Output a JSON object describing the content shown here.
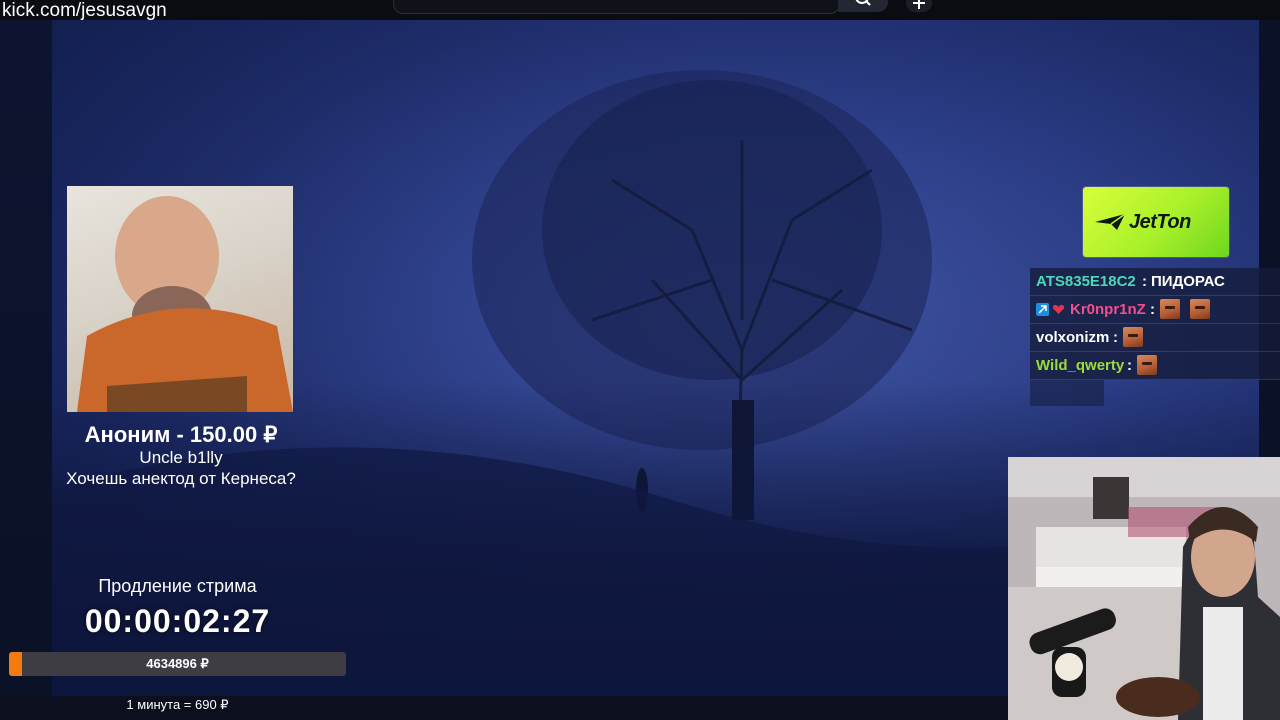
{
  "url": "kick.com/jesusavgn",
  "icons": {
    "search": "search-icon",
    "plus": "plus-icon",
    "sponsor_logo": "paper-plane-logo-icon",
    "chat_badge": "chat-badge-icon",
    "chat_heart": "heart-badge-icon",
    "emote": "emote-icon"
  },
  "donation": {
    "amount_line": "Аноним - 150.00 ₽",
    "name": "Uncle b1lly",
    "message": "Хочешь анектод от Кернеса?"
  },
  "extension": {
    "title": "Продление стрима",
    "timer": "00:00:02:27",
    "total": "4634896 ₽",
    "progress_fraction": 0.04,
    "rate": "1 минута = 690 ₽"
  },
  "sponsor": {
    "name": "JetTon"
  },
  "chat": [
    {
      "user": "ATS835E18C2",
      "user_color": "#4fd8b7",
      "text": "ПИДОРАС",
      "emotes": 0
    },
    {
      "user": "Kr0npr1nZ",
      "user_color": "#f24f8a",
      "text": "",
      "emotes": 2
    },
    {
      "user": "volxonizm",
      "user_color": "#ffffff",
      "text": "",
      "emotes": 1
    },
    {
      "user": "Wild_qwerty",
      "user_color": "#9bdc3c",
      "text": "",
      "emotes": 1
    }
  ],
  "colors": {
    "accent_orange": "#f47c0f",
    "sponsor_green": "#b6f32d",
    "scene_blue": "#2c3f8a"
  }
}
